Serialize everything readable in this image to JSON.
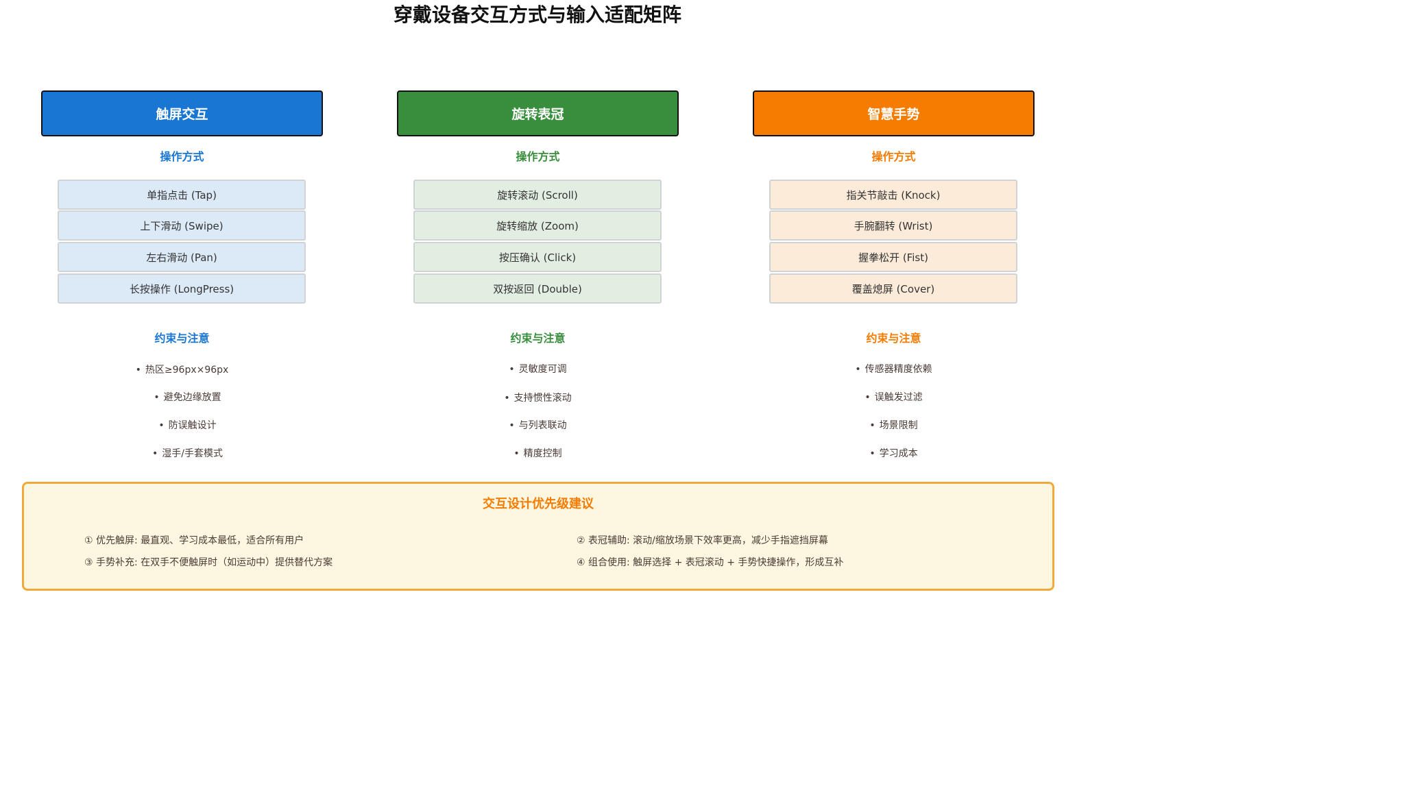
{
  "title": "穿戴设备交互方式与输入适配矩阵",
  "colors": {
    "touch": "#1976d2",
    "crown": "#388e3c",
    "gesture": "#f57c00",
    "touch_item_bg": "#dce9f7",
    "crown_item_bg": "#e2eee2",
    "gesture_item_bg": "#fcebd9",
    "priority_bg": "#fdf7e1",
    "priority_border": "#f2a93b"
  },
  "columns": [
    {
      "header": "触屏交互",
      "ops_title": "操作方式",
      "ops": [
        "单指点击 (Tap)",
        "上下滑动 (Swipe)",
        "左右滑动 (Pan)",
        "长按操作 (LongPress)"
      ],
      "cons_title": "约束与注意",
      "cons": [
        "热区≥96px×96px",
        "避免边缘放置",
        "防误触设计",
        "湿手/手套模式"
      ]
    },
    {
      "header": "旋转表冠",
      "ops_title": "操作方式",
      "ops": [
        "旋转滚动 (Scroll)",
        "旋转缩放 (Zoom)",
        "按压确认 (Click)",
        "双按返回 (Double)"
      ],
      "cons_title": "约束与注意",
      "cons": [
        "灵敏度可调",
        "支持惯性滚动",
        "与列表联动",
        "精度控制"
      ]
    },
    {
      "header": "智慧手势",
      "ops_title": "操作方式",
      "ops": [
        "指关节敲击 (Knock)",
        "手腕翻转 (Wrist)",
        "握拳松开 (Fist)",
        "覆盖熄屏 (Cover)"
      ],
      "cons_title": "约束与注意",
      "cons": [
        "传感器精度依赖",
        "误触发过滤",
        "场景限制",
        "学习成本"
      ]
    }
  ],
  "bullet": "•",
  "priority": {
    "title": "交互设计优先级建议",
    "items": [
      "① 优先触屏: 最直观、学习成本最低，适合所有用户",
      "② 表冠辅助: 滚动/缩放场景下效率更高，减少手指遮挡屏幕",
      "③ 手势补充: 在双手不便触屏时（如运动中）提供替代方案",
      "④ 组合使用: 触屏选择 + 表冠滚动 + 手势快捷操作，形成互补"
    ]
  }
}
